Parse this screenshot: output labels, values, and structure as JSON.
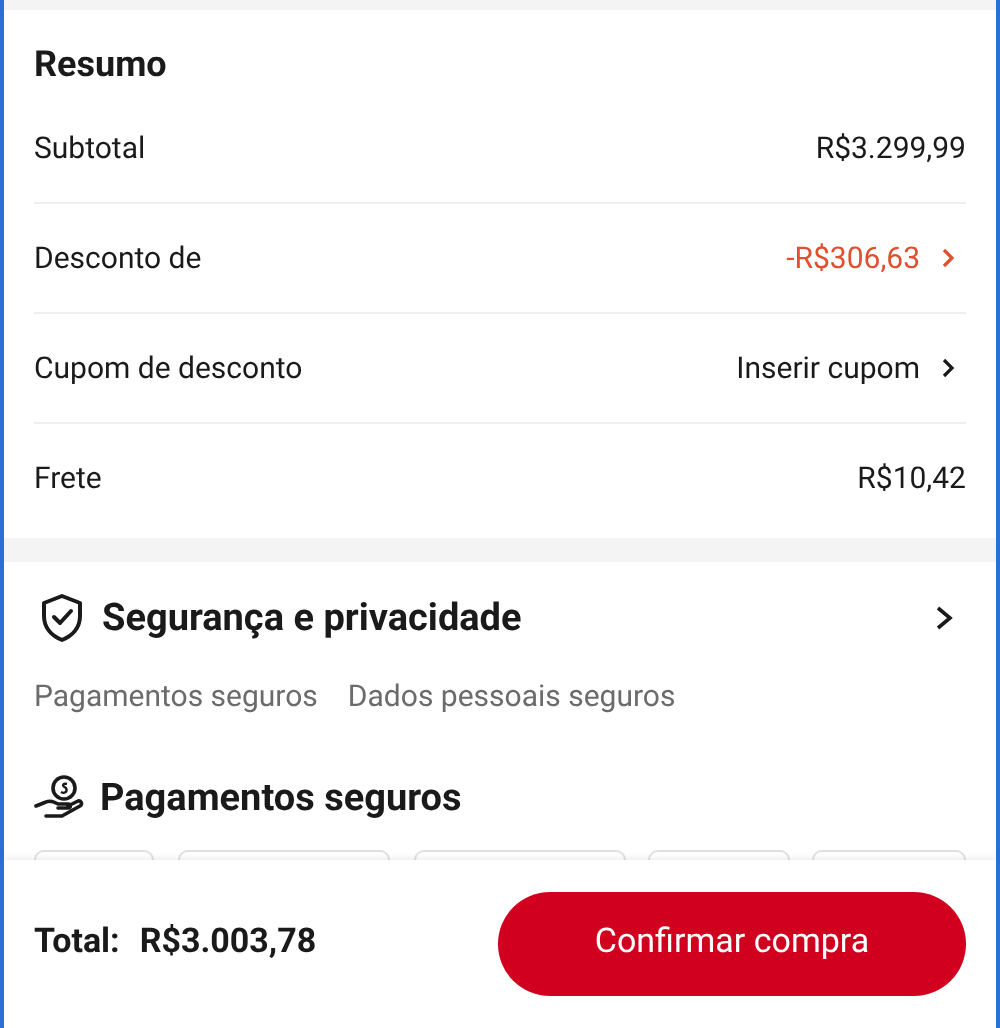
{
  "summary": {
    "title": "Resumo",
    "rows": [
      {
        "kind": "amount",
        "label": "Subtotal",
        "value": "R$3.299,99"
      },
      {
        "kind": "discount",
        "label": "Desconto de",
        "value": "-R$306,63"
      },
      {
        "kind": "link",
        "label": "Cupom de desconto",
        "value": "Inserir cupom"
      },
      {
        "kind": "amount",
        "label": "Frete",
        "value": "R$10,42"
      }
    ]
  },
  "security": {
    "title": "Segurança e privacidade",
    "tags": [
      "Pagamentos seguros",
      "Dados pessoais seguros"
    ],
    "payments_title": "Pagamentos seguros"
  },
  "footer": {
    "total_label": "Total:",
    "total_value": "R$3.003,78",
    "button": "Confirmar compra"
  }
}
